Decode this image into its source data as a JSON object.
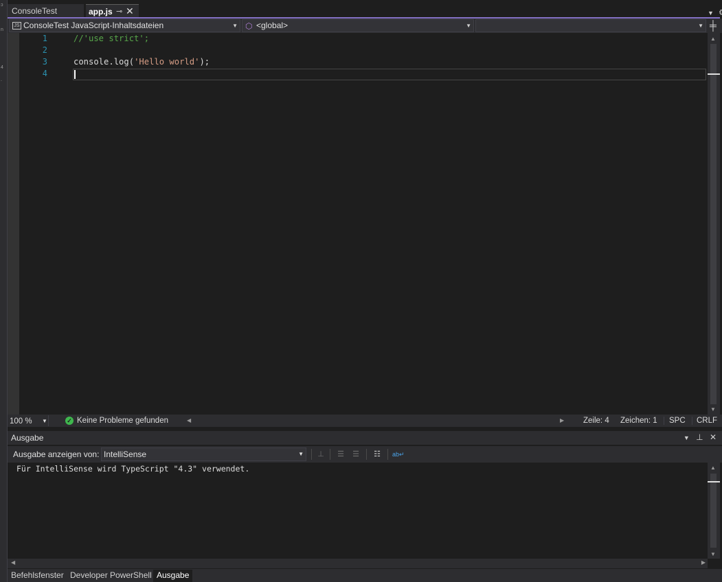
{
  "tabs": [
    {
      "label": "ConsoleTest",
      "active": false
    },
    {
      "label": "app.js",
      "active": true
    }
  ],
  "navbar": {
    "project": "ConsoleTest JavaScript-Inhaltsdateien",
    "project_icon": "JS",
    "scope": "<global>",
    "member": ""
  },
  "editor": {
    "lines": [
      {
        "number": "1",
        "segments": [
          {
            "text": "//'use strict';",
            "kind": "comment"
          }
        ]
      },
      {
        "number": "2",
        "segments": []
      },
      {
        "number": "3",
        "segments": [
          {
            "text": "console.log(",
            "kind": "plain"
          },
          {
            "text": "'Hello world'",
            "kind": "string"
          },
          {
            "text": ");",
            "kind": "plain"
          }
        ]
      },
      {
        "number": "4",
        "segments": []
      }
    ],
    "current_line": 4
  },
  "status": {
    "zoom": "100 %",
    "problems": "Keine Probleme gefunden",
    "line": "Zeile: 4",
    "column": "Zeichen: 1",
    "spacing": "SPC",
    "line_ending": "CRLF"
  },
  "output": {
    "title": "Ausgabe",
    "show_from_label": "Ausgabe anzeigen von:",
    "source": "IntelliSense",
    "text": "Für IntelliSense wird TypeScript \"4.3\" verwendet."
  },
  "bottom_tabs": [
    {
      "label": "Befehlsfenster",
      "active": false
    },
    {
      "label": "Developer PowerShell",
      "active": false
    },
    {
      "label": "Ausgabe",
      "active": true
    }
  ],
  "colors": {
    "accent": "#8572c8",
    "comment": "#57a64a",
    "string": "#d69d85",
    "line_number": "#2b91af",
    "success": "#3fb74e"
  }
}
